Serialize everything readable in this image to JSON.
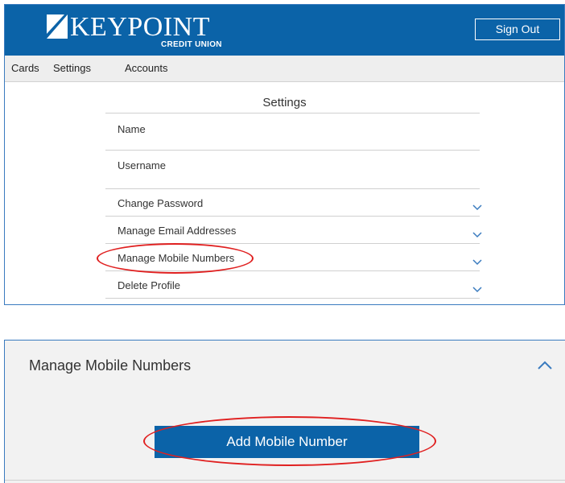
{
  "brand": {
    "name": "KEYPOINT",
    "sub": "CREDIT UNION",
    "color": "#0b63a8"
  },
  "header": {
    "signout_label": "Sign Out"
  },
  "nav": [
    "Cards",
    "Settings",
    "Accounts"
  ],
  "settings": {
    "title": "Settings",
    "fields": [
      {
        "label": "Name"
      },
      {
        "label": "Username"
      }
    ],
    "sections": [
      {
        "label": "Change Password",
        "icon": "chevron-down-icon"
      },
      {
        "label": "Manage Email Addresses",
        "icon": "chevron-down-icon"
      },
      {
        "label": "Manage Mobile Numbers",
        "icon": "chevron-down-icon"
      },
      {
        "label": "Delete Profile",
        "icon": "chevron-down-icon"
      }
    ]
  },
  "expanded": {
    "title": "Manage Mobile Numbers",
    "icon": "chevron-up-icon",
    "add_button_label": "Add Mobile Number"
  },
  "annotation_color": "#e02020"
}
